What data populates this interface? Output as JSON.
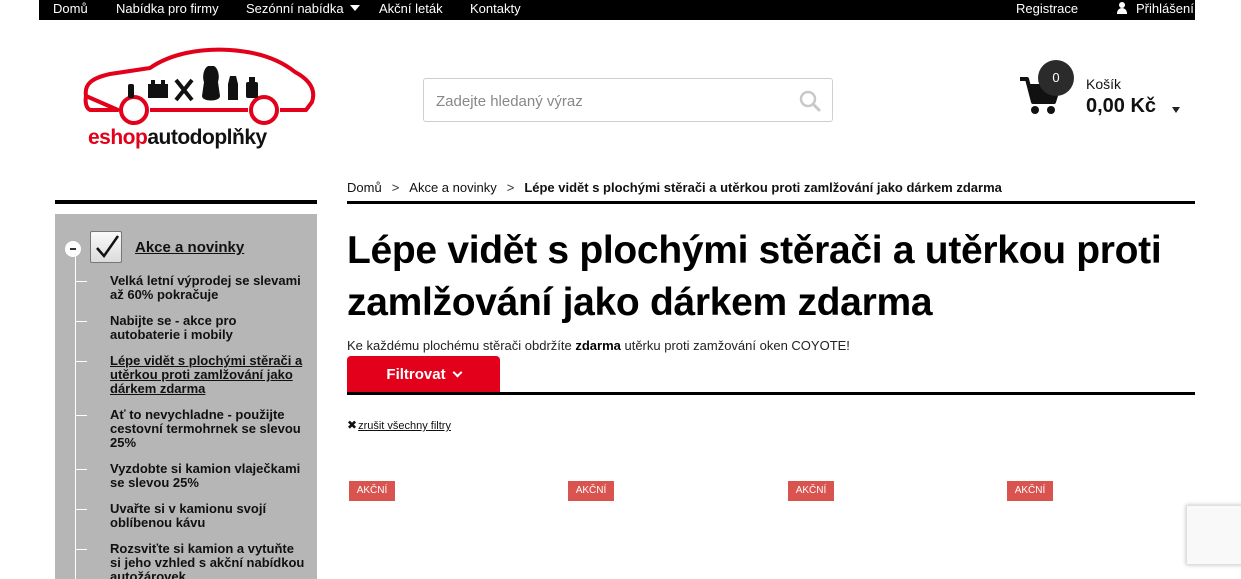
{
  "topnav": {
    "left": [
      "Domů",
      "Nabídka pro firmy",
      "Sezónní nabídka",
      "Akční leták",
      "Kontakty"
    ],
    "register": "Registrace",
    "login": "Přihlášení"
  },
  "logo": {
    "part1": "eshop",
    "part2": "autodoplňky"
  },
  "search": {
    "placeholder": "Zadejte hledaný výraz"
  },
  "cart": {
    "count": "0",
    "label": "Košík",
    "total": "0,00 Kč"
  },
  "sidebar": {
    "title": "Akce a novinky",
    "items": [
      "Velká letní výprodej se slevami až 60% pokračuje",
      "Nabijte se - akce pro autobaterie i mobily",
      "Lépe vidět s plochými stěrači a utěrkou proti zamlžování jako dárkem zdarma",
      "Ať to nevychladne - použijte cestovní termohrnek se slevou 25%",
      "Vyzdobte si kamion vlaječkami se slevou 25%",
      "Uvařte si v kamionu svojí oblíbenou kávu",
      "Rozsviťte si kamion a vytuňte si jeho vzhled s akční nabídkou autožárovek"
    ]
  },
  "breadcrumb": {
    "home": "Domů",
    "category": "Akce a novinky",
    "current": "Lépe vidět s plochými stěrači a utěrkou proti zamlžování jako dárkem zdarma"
  },
  "page_title": "Lépe vidět s plochými stěrači a utěrkou proti zamlžování jako dárkem zdarma",
  "description": {
    "before": "Ke každému plochému stěrači obdržíte ",
    "bold": "zdarma",
    "after": " utěrku proti zamžování oken COYOTE!"
  },
  "filter_label": "Filtrovat",
  "clear_filters": "zrušit všechny filtry",
  "badge_label": "AKČNÍ",
  "colors": {
    "brand_red": "#e2001a",
    "badge_red": "#d9534f",
    "sidebar_bg": "#b6b6b6"
  }
}
